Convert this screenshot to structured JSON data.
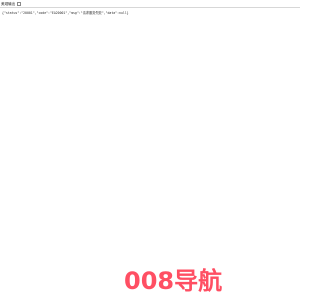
{
  "toolbar": {
    "title": "美观输出"
  },
  "response": {
    "text": "{\"status\":\"20001\",\"code\":\"EA20001\",\"msg\":\"请求服务失败\",\"data\":null}"
  },
  "brand": {
    "logo_text": "008导航",
    "color": "#ff4f63"
  }
}
